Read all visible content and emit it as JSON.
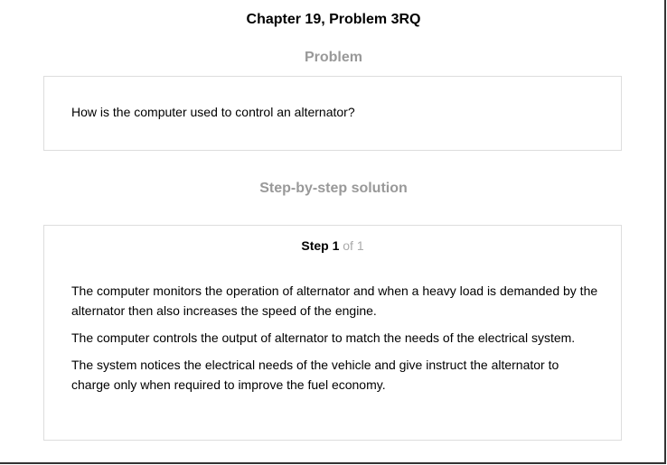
{
  "header": {
    "title": "Chapter 19, Problem 3RQ"
  },
  "problem": {
    "heading": "Problem",
    "text": "How is the computer used to control an alternator?"
  },
  "solution": {
    "heading": "Step-by-step solution",
    "step": {
      "label": "Step 1",
      "of_label": "of 1",
      "paragraphs": [
        "The computer monitors the operation of alternator and when a heavy load is demanded by the alternator then also increases the speed of the engine.",
        "The computer controls the output of alternator to match the needs of the electrical system.",
        "The system notices the electrical needs of the vehicle and give instruct the alternator to charge only when required to improve the fuel economy."
      ]
    }
  },
  "colors": {
    "heading_gray": "#999999",
    "box_border": "#dddddd",
    "step_of_gray": "#aaaaaa"
  }
}
